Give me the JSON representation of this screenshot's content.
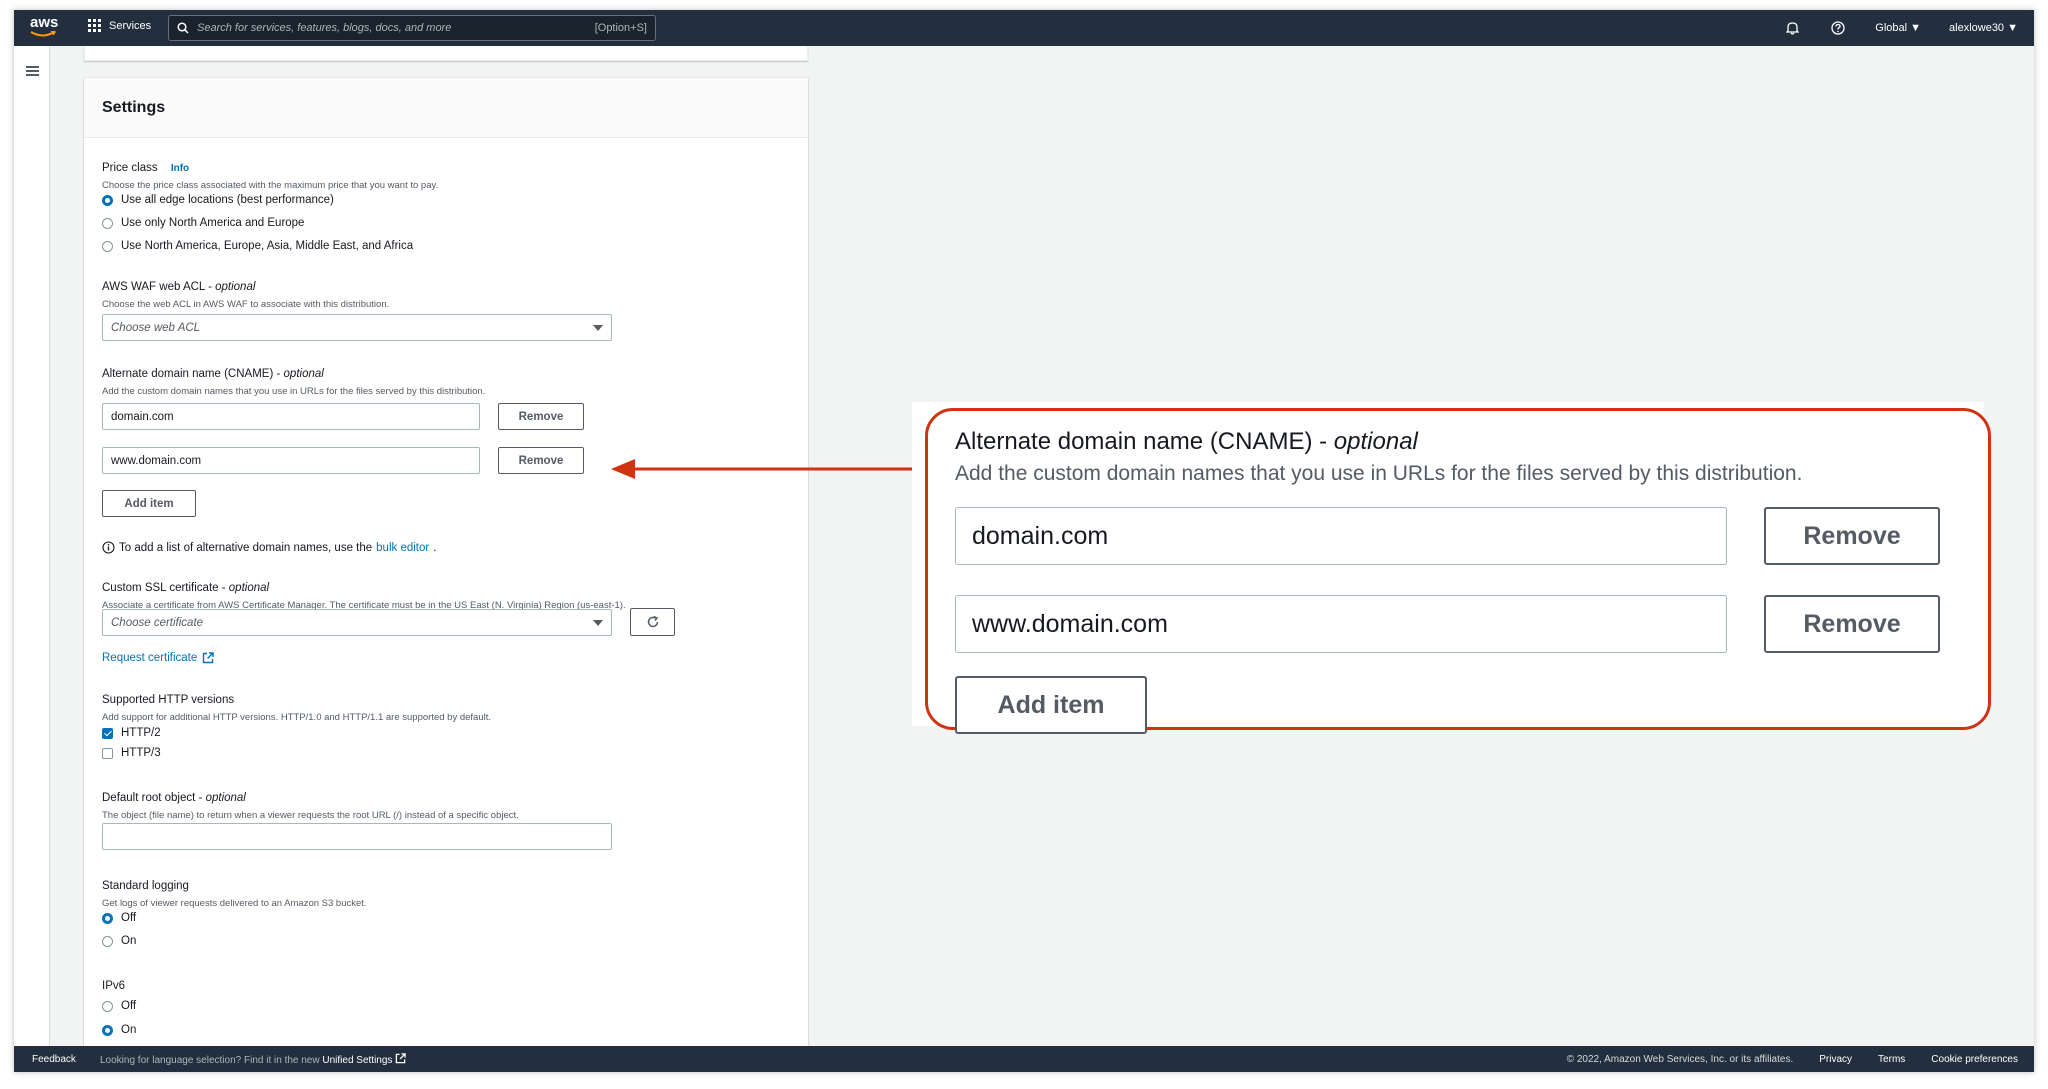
{
  "topnav": {
    "logo_text": "aws",
    "services_label": "Services",
    "search_placeholder": "Search for services, features, blogs, docs, and more",
    "search_shortcut": "[Option+S]",
    "region_label": "Global ▼",
    "account_label": "alexlowe30 ▼",
    "icons": [
      "bell-icon",
      "help-icon"
    ]
  },
  "settings": {
    "title": "Settings",
    "price_class": {
      "label": "Price class",
      "info": "Info",
      "description": "Choose the price class associated with the maximum price that you want to pay.",
      "options": [
        "Use all edge locations (best performance)",
        "Use only North America and Europe",
        "Use North America, Europe, Asia, Middle East, and Africa"
      ],
      "selected_index": 0
    },
    "waf": {
      "label": "AWS WAF web ACL",
      "optional": "optional",
      "description": "Choose the web ACL in AWS WAF to associate with this distribution.",
      "placeholder": "Choose web ACL"
    },
    "cname": {
      "label": "Alternate domain name (CNAME)",
      "optional": "optional",
      "description": "Add the custom domain names that you use in URLs for the files served by this distribution.",
      "items": [
        "domain.com",
        "www.domain.com"
      ],
      "remove_label": "Remove",
      "add_label": "Add item",
      "bulk_note": "To add a list of alternative domain names, use the",
      "bulk_link": "bulk editor"
    },
    "ssl": {
      "label": "Custom SSL certificate",
      "optional": "optional",
      "description": "Associate a certificate from AWS Certificate Manager. The certificate must be in the US East (N. Virginia) Region (us-east-1).",
      "placeholder": "Choose certificate",
      "request_link": "Request certificate"
    },
    "http": {
      "label": "Supported HTTP versions",
      "description": "Add support for additional HTTP versions. HTTP/1.0 and HTTP/1.1 are supported by default.",
      "options": [
        "HTTP/2",
        "HTTP/3"
      ],
      "checked": [
        true,
        false
      ]
    },
    "root_object": {
      "label": "Default root object",
      "optional": "optional",
      "description": "The object (file name) to return when a viewer requests the root URL (/) instead of a specific object.",
      "value": ""
    },
    "logging": {
      "label": "Standard logging",
      "description": "Get logs of viewer requests delivered to an Amazon S3 bucket.",
      "options": [
        "Off",
        "On"
      ],
      "selected_index": 0
    },
    "ipv6": {
      "label": "IPv6",
      "options": [
        "Off",
        "On"
      ],
      "selected_index": 1
    }
  },
  "callout": {
    "label": "Alternate domain name (CNAME)",
    "optional": "optional",
    "description": "Add the custom domain names that you use in URLs for the files served by this distribution.",
    "items": [
      "domain.com",
      "www.domain.com"
    ],
    "remove_label": "Remove",
    "add_label": "Add item",
    "accent_color": "#d13212"
  },
  "footer": {
    "feedback": "Feedback",
    "lang_text": "Looking for language selection? Find it in the new",
    "lang_link": "Unified Settings",
    "copyright": "© 2022, Amazon Web Services, Inc. or its affiliates.",
    "links": [
      "Privacy",
      "Terms",
      "Cookie preferences"
    ]
  }
}
